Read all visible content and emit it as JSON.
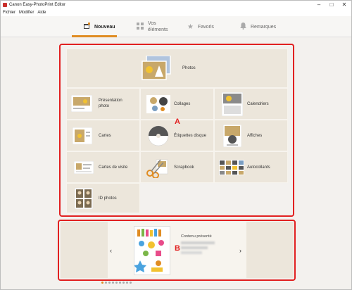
{
  "window": {
    "title": "Canon Easy-PhotoPrint Editor",
    "controls": [
      "–",
      "□",
      "✕"
    ]
  },
  "menu": [
    "Fichier",
    "Modifier",
    "Aide"
  ],
  "tabs": [
    {
      "label": "Nouveau",
      "icon": "new-document-icon",
      "active": true
    },
    {
      "label": "Vos éléments",
      "label_line1": "Vos",
      "label_line2": "éléments",
      "icon": "grid-icon",
      "active": false
    },
    {
      "label": "Favoris",
      "icon": "star-icon",
      "active": false
    },
    {
      "label": "Remarques",
      "icon": "bell-icon",
      "active": false
    }
  ],
  "templates": {
    "photos": "Photos",
    "items": [
      {
        "label": "Présentation photo",
        "label_line1": "Présentation",
        "label_line2": "photo",
        "icon": "photo-layout-icon"
      },
      {
        "label": "Collages",
        "icon": "collage-icon"
      },
      {
        "label": "Calendriers",
        "icon": "calendar-icon"
      },
      {
        "label": "Cartes",
        "icon": "card-icon"
      },
      {
        "label": "Étiquettes disque",
        "icon": "disc-label-icon"
      },
      {
        "label": "Affiches",
        "icon": "poster-icon"
      },
      {
        "label": "Cartes de visite",
        "icon": "business-card-icon"
      },
      {
        "label": "Scrapbook",
        "icon": "scissors-icon"
      },
      {
        "label": "Autocollants",
        "icon": "sticker-sheet-icon"
      },
      {
        "label": "ID photos",
        "icon": "id-photo-icon"
      }
    ]
  },
  "featured": {
    "heading": "Contenu présenté",
    "prev": "‹",
    "next": "›",
    "dots": 9,
    "active_dot": 1
  },
  "markers": {
    "a": "A",
    "b": "B"
  },
  "colors": {
    "accent": "#e08c22",
    "highlight": "#e12020",
    "tile_bg": "#ece6db"
  }
}
